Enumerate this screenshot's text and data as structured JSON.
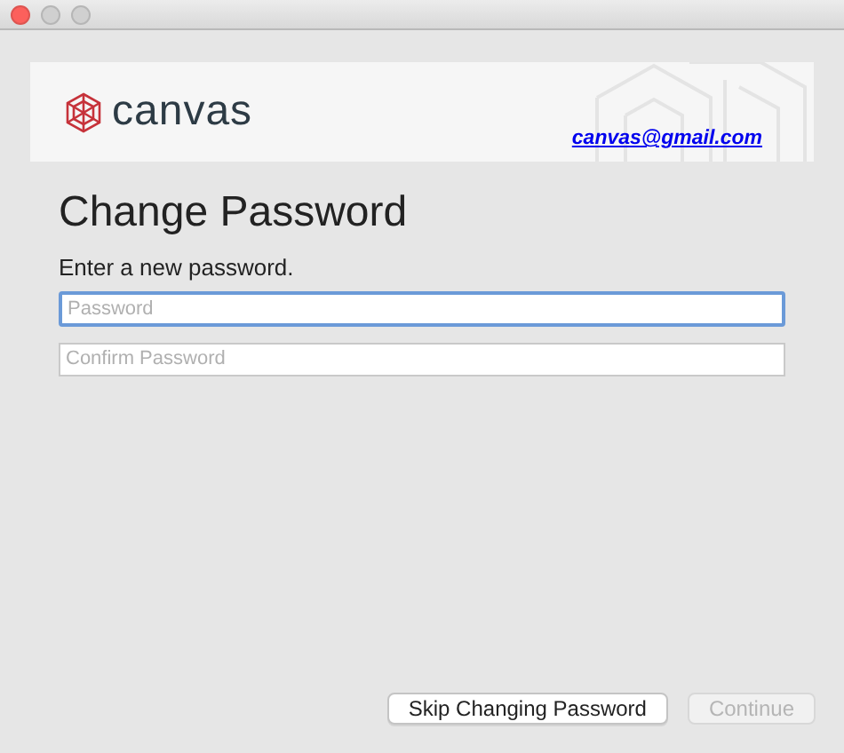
{
  "window": {
    "controls": [
      {
        "kind": "close"
      },
      {
        "kind": "minimize"
      },
      {
        "kind": "zoom"
      }
    ]
  },
  "banner": {
    "logo_text": "canvas",
    "email": "canvas@gmail.com"
  },
  "title": "Change Password",
  "instruction": "Enter a new password.",
  "fields": [
    {
      "placeholder": "Password",
      "focused": true
    },
    {
      "placeholder": "Confirm Password",
      "focused": false
    }
  ],
  "buttons": [
    {
      "label": "Skip Changing Password",
      "disabled": false
    },
    {
      "label": "Continue",
      "disabled": true
    }
  ]
}
